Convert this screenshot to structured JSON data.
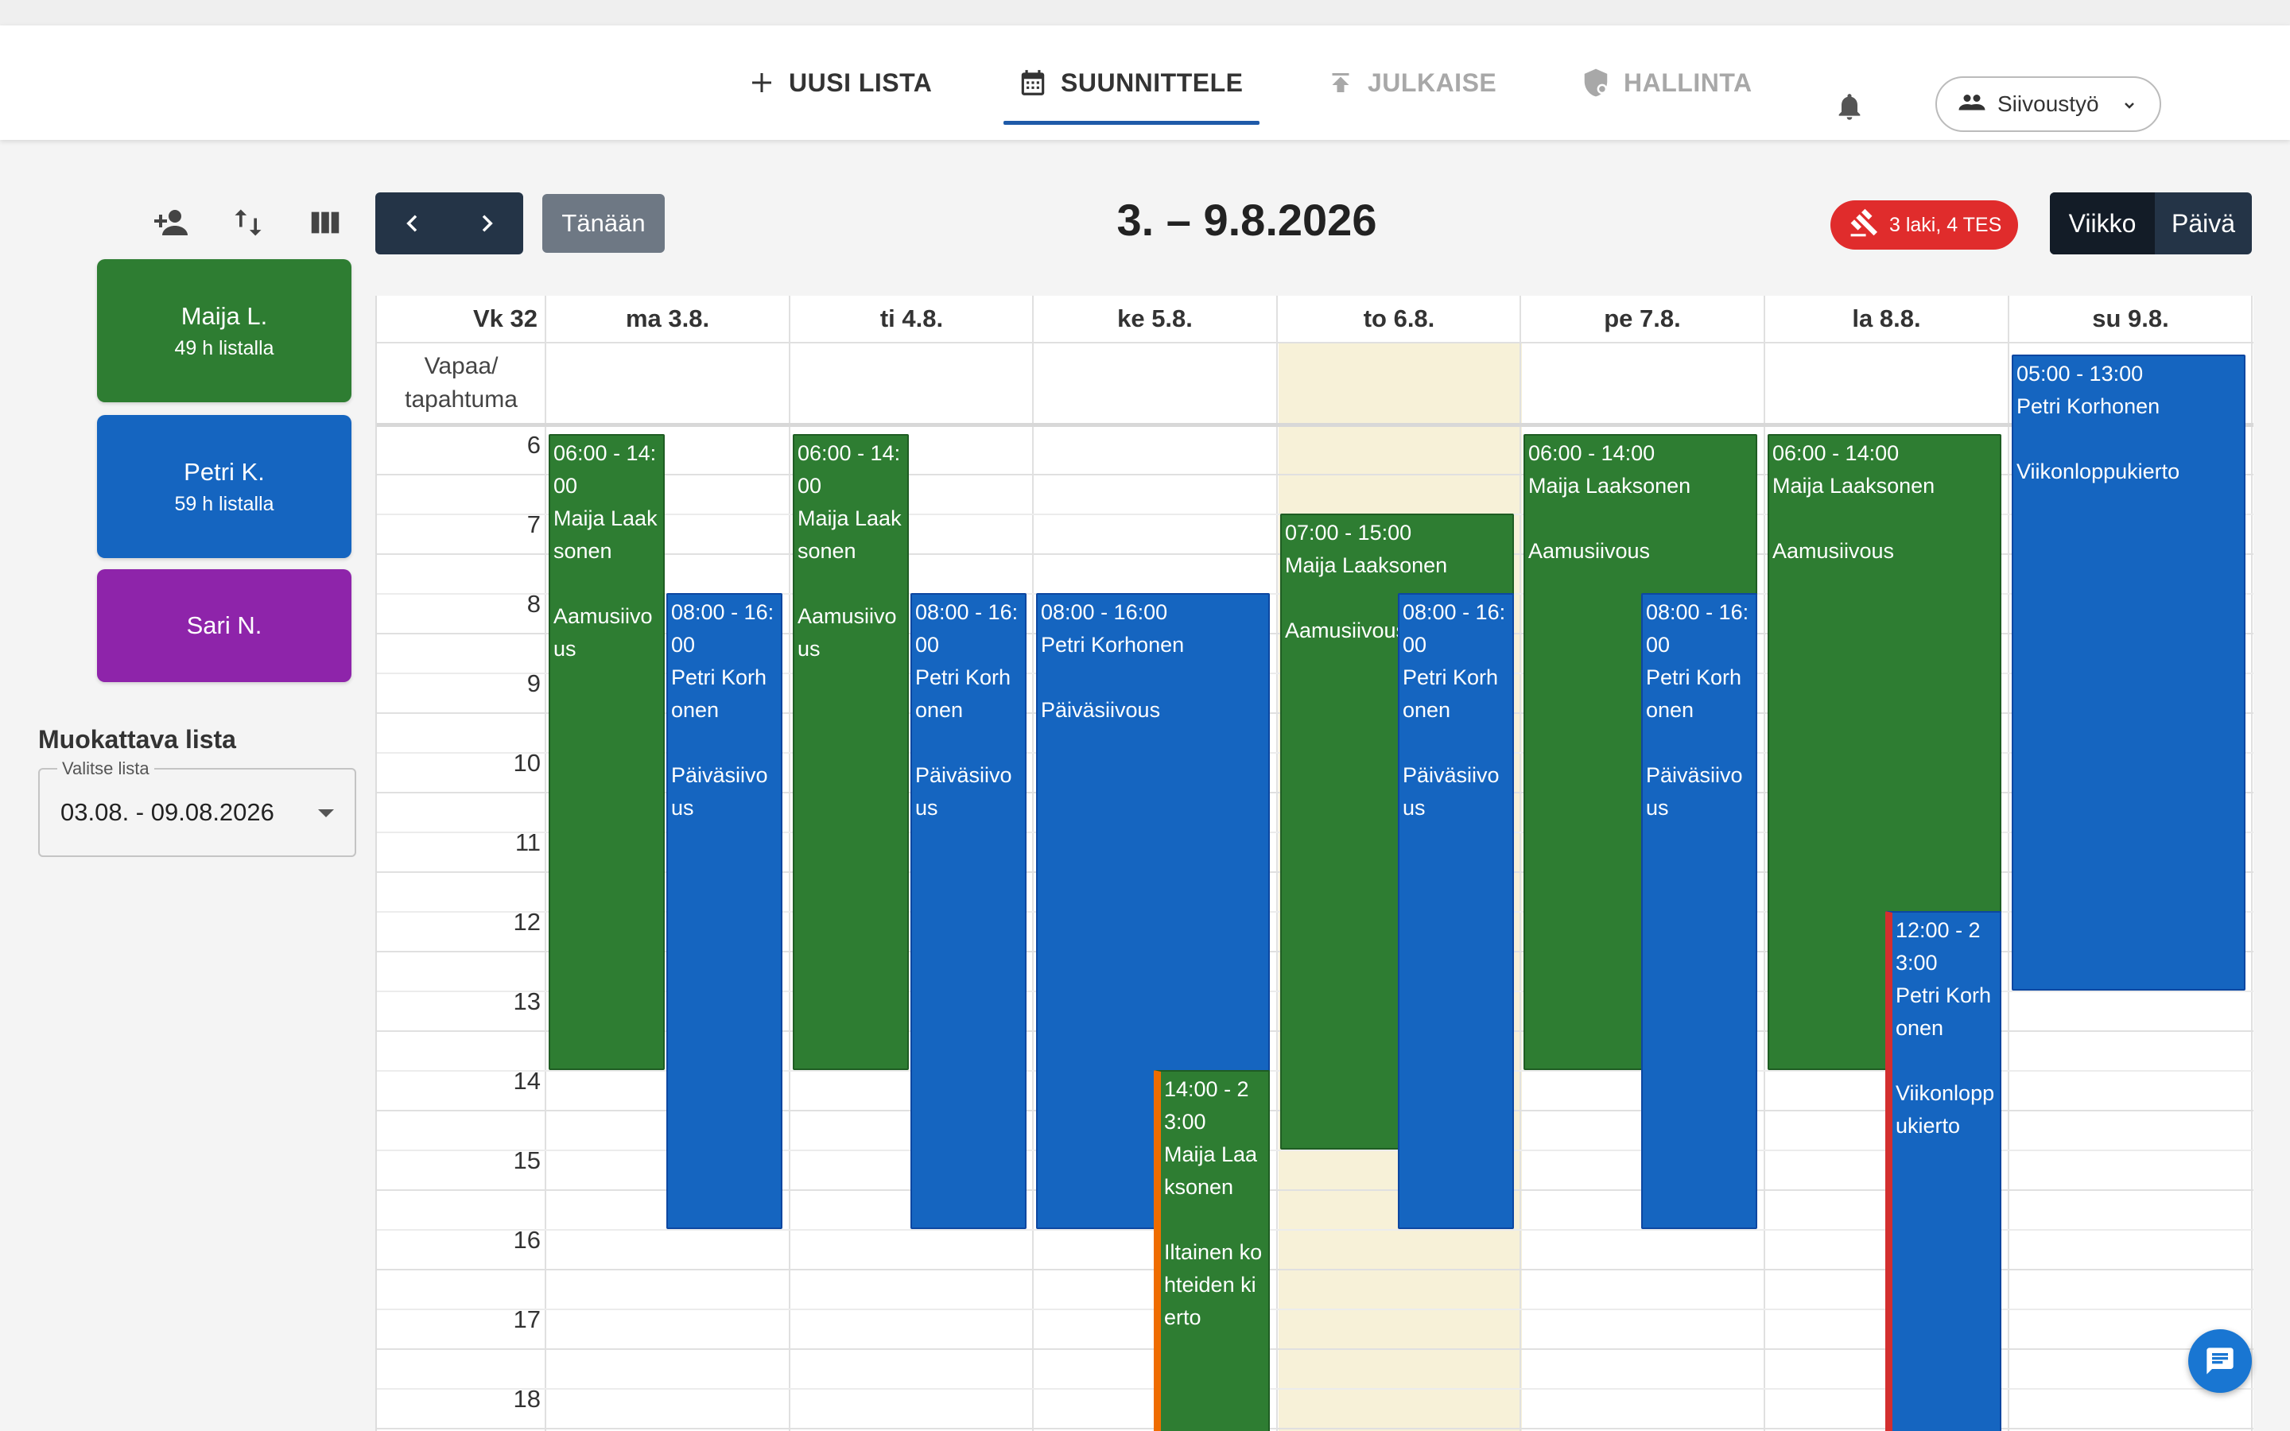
{
  "nav": {
    "new_list": "UUSI LISTA",
    "plan": "SUUNNITTELE",
    "publish": "JULKAISE",
    "admin": "HALLINTA",
    "team": "Siivoustyö"
  },
  "employees": [
    {
      "name": "Maija L.",
      "hours": "49 h listalla",
      "color": "#2e7d32"
    },
    {
      "name": "Petri K.",
      "hours": "59 h listalla",
      "color": "#1565c0"
    },
    {
      "name": "Sari N.",
      "hours": "",
      "color": "#8e24aa"
    }
  ],
  "list": {
    "title": "Muokattava lista",
    "select_label": "Valitse lista",
    "value": "03.08. - 09.08.2026"
  },
  "toolbar": {
    "today": "Tänään",
    "range": "3. – 9.8.2026",
    "warning": "3 laki, 4 TES",
    "view_week": "Viikko",
    "view_day": "Päivä"
  },
  "calendar": {
    "week": "Vk 32",
    "days": [
      "ma 3.8.",
      "ti 4.8.",
      "ke 5.8.",
      "to 6.8.",
      "pe 7.8.",
      "la 8.8.",
      "su 9.8."
    ],
    "free_label": "Vapaa/ tapahtuma",
    "hours": [
      "6",
      "7",
      "8",
      "9",
      "10",
      "11",
      "12",
      "13",
      "14",
      "15",
      "16",
      "17",
      "18"
    ]
  },
  "shifts": [
    {
      "time": "06:00 - 14:00",
      "person": "Maija Laaksonen",
      "task": "Aamusiivous",
      "color": "green"
    },
    {
      "time": "08:00 - 16:00",
      "person": "Petri Korhonen",
      "task": "Päiväsiivous",
      "color": "blue"
    },
    {
      "time": "06:00 - 14:00",
      "person": "Maija Laaksonen",
      "task": "Aamusiivous",
      "color": "green"
    },
    {
      "time": "08:00 - 16:00",
      "person": "Petri Korhonen",
      "task": "Päiväsiivous",
      "color": "blue"
    },
    {
      "time": "08:00 - 16:00",
      "person": "Petri Korhonen",
      "task": "Päiväsiivous",
      "color": "blue"
    },
    {
      "time": "14:00 - 23:00",
      "person": "Maija Laaksonen",
      "task": "Iltainen kohteiden kierto",
      "color": "green"
    },
    {
      "time": "07:00 - 15:00",
      "person": "Maija Laaksonen",
      "task": "Aamusiivous",
      "color": "green"
    },
    {
      "time": "08:00 - 16:00",
      "person": "Petri Korhonen",
      "task": "Päiväsiivous",
      "color": "blue"
    },
    {
      "time": "06:00 - 14:00",
      "person": "Maija Laaksonen",
      "task": "Aamusiivous",
      "color": "green"
    },
    {
      "time": "08:00 - 16:00",
      "person": "Petri Korhonen",
      "task": "Päiväsiivous",
      "color": "blue"
    },
    {
      "time": "06:00 - 14:00",
      "person": "Maija Laaksonen",
      "task": "Aamusiivous",
      "color": "green"
    },
    {
      "time": "12:00 - 23:00",
      "person": "Petri Korhonen",
      "task": "Viikonloppukierto",
      "color": "blue"
    },
    {
      "time": "05:00 - 13:00",
      "person": "Petri Korhonen",
      "task": "Viikonloppukierto",
      "color": "blue"
    }
  ],
  "colors": {
    "primary": "#1e5aa8",
    "green": "#2e7d32",
    "blue": "#1565c0",
    "purple": "#8e24aa",
    "danger": "#e02c2c",
    "dark": "#243447"
  }
}
